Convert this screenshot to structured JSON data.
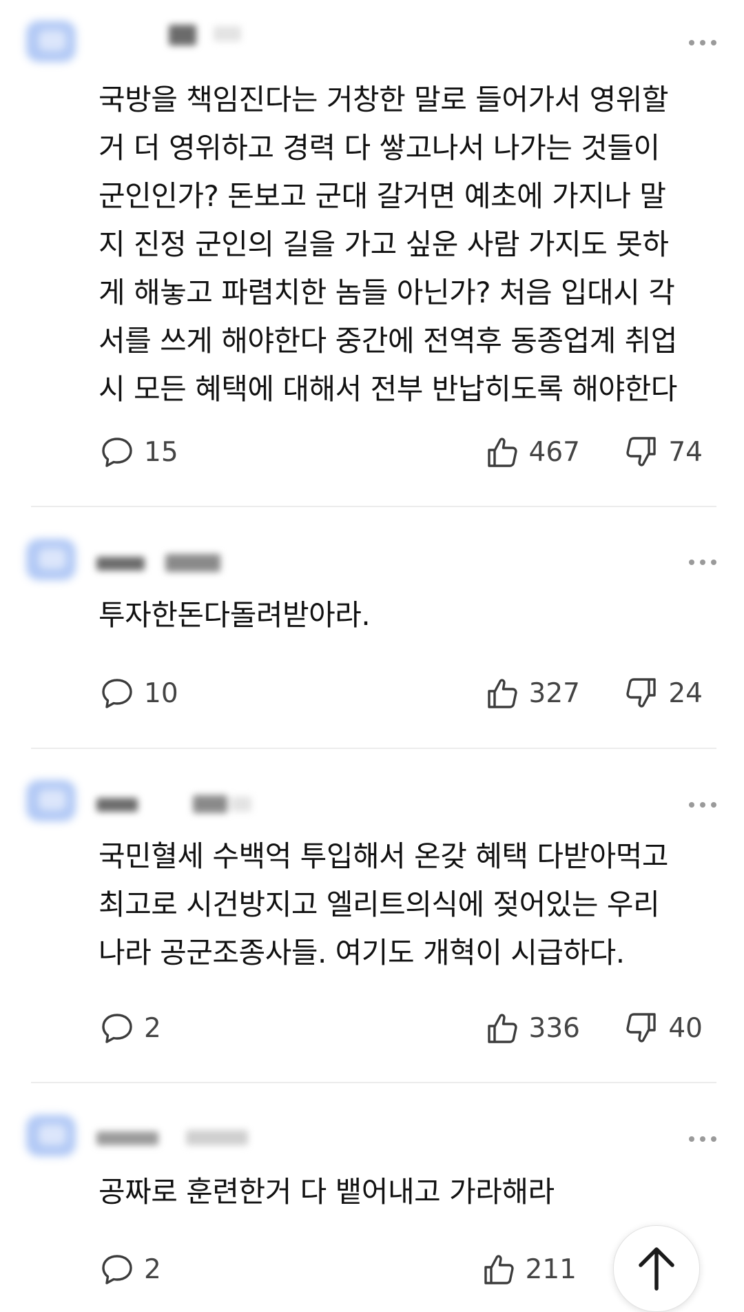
{
  "colors": {
    "text": "#111111",
    "meta": "#444444",
    "divider": "#ececec",
    "avatar": "#a8c2f4"
  },
  "comments": [
    {
      "text": "국방을 책임진다는 거창한 말로 들어가서 영위할\n거 더 영위하고 경력 다 쌓고나서 나가는 것들이\n군인인가? 돈보고 군대 갈거면 예초에 가지나 말\n지 진정 군인의 길을 가고 싶운 사람 가지도 못하\n게 해놓고 파렴치한 놈들 아닌가? 처음 입대시 각\n서를 쓰게 해야한다 중간에 전역후 동종업계 취업\n시 모든 혜택에 대해서 전부 반납히도록 해야한다",
      "replies": "15",
      "likes": "467",
      "dislikes": "74"
    },
    {
      "text": "투자한돈다돌려받아라.",
      "replies": "10",
      "likes": "327",
      "dislikes": "24"
    },
    {
      "text": "국민혈세 수백억 투입해서 온갖 혜택 다받아먹고\n최고로 시건방지고 엘리트의식에 젖어있는 우리\n나라 공군조종사들. 여기도 개혁이 시급하다.",
      "replies": "2",
      "likes": "336",
      "dislikes": "40"
    },
    {
      "text": "공짜로 훈련한거 다 뱉어내고 가라해라",
      "replies": "2",
      "likes": "211",
      "dislikes": ""
    }
  ],
  "icons": {
    "more": "more-horizontal-icon",
    "reply": "speech-bubble-icon",
    "like": "thumbs-up-icon",
    "dislike": "thumbs-down-icon",
    "scroll_top": "arrow-up-icon"
  }
}
